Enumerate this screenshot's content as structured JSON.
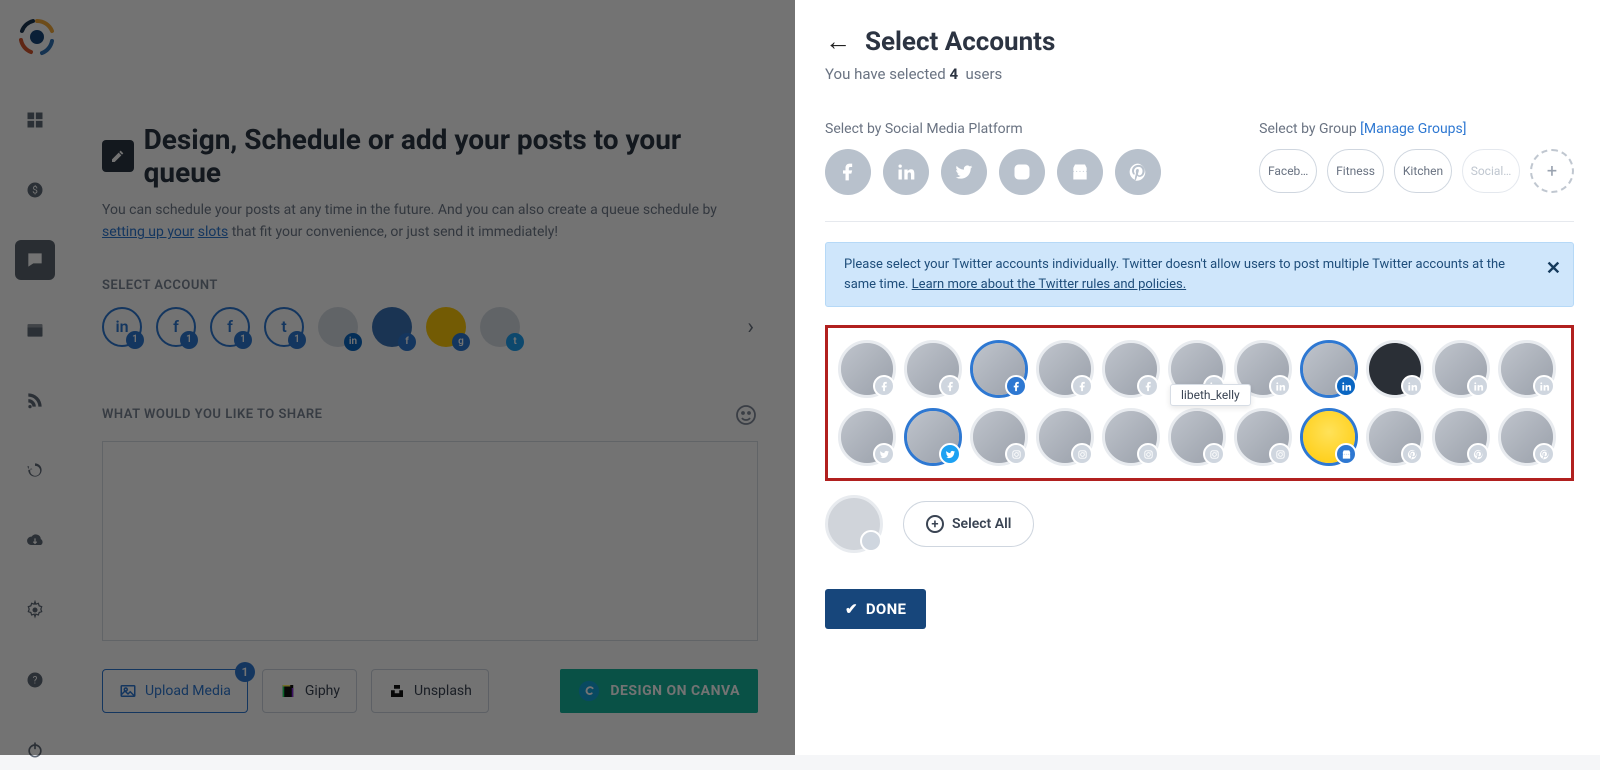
{
  "colors": {
    "accent": "#2e78d2",
    "done": "#17467b",
    "highlight_border": "#b1201f",
    "alert_bg": "#cfe6fb"
  },
  "header": {
    "title": "Design, Schedule or add your posts to your queue",
    "sub_prefix": "You can schedule your posts at any time in the future. And you can also create a queue schedule by ",
    "sub_link1": "setting up your",
    "sub_mid": " ",
    "sub_link2": "slots",
    "sub_suffix": " that fit your convenience, or just send it immediately!"
  },
  "select_account_label": "SELECT ACCOUNT",
  "share_label": "WHAT WOULD YOU LIKE TO SHARE",
  "media": {
    "upload": "Upload Media",
    "upload_badge": "1",
    "giphy": "Giphy",
    "unsplash": "Unsplash",
    "canva": "DESIGN ON CANVA"
  },
  "panel": {
    "title": "Select Accounts",
    "selected_prefix": "You have selected ",
    "selected_count": "4",
    "selected_suffix": "users",
    "platform_label": "Select by Social Media Platform",
    "group_label": "Select by Group ",
    "manage_groups": "[Manage Groups]",
    "groups": [
      "Faceb…",
      "Fitness",
      "Kitchen",
      "Social…"
    ],
    "alert_text": "Please select your Twitter accounts individually. Twitter doesn't allow users to post multiple Twitter accounts at the same time.",
    "alert_link": "Learn more about the Twitter rules and policies.",
    "tooltip": "libeth_kelly",
    "select_all": "Select All",
    "done": "DONE"
  },
  "accounts": [
    {
      "network": "facebook",
      "selected": false
    },
    {
      "network": "facebook",
      "selected": false
    },
    {
      "network": "facebook",
      "selected": true,
      "variant": "blue"
    },
    {
      "network": "facebook",
      "selected": false
    },
    {
      "network": "facebook",
      "selected": false
    },
    {
      "network": "linkedin",
      "selected": false
    },
    {
      "network": "linkedin",
      "selected": false
    },
    {
      "network": "linkedin",
      "selected": true
    },
    {
      "network": "linkedin",
      "selected": false,
      "variant": "dark"
    },
    {
      "network": "linkedin",
      "selected": false
    },
    {
      "network": "linkedin",
      "selected": false
    },
    {
      "network": "twitter",
      "selected": false
    },
    {
      "network": "twitter",
      "selected": true
    },
    {
      "network": "instagram",
      "selected": false
    },
    {
      "network": "instagram",
      "selected": false
    },
    {
      "network": "instagram",
      "selected": false
    },
    {
      "network": "instagram",
      "selected": false
    },
    {
      "network": "instagram",
      "selected": false
    },
    {
      "network": "gmb",
      "selected": true,
      "variant": "yellow"
    },
    {
      "network": "pinterest",
      "selected": false
    },
    {
      "network": "pinterest",
      "selected": false
    },
    {
      "network": "pinterest",
      "selected": false
    }
  ],
  "platform_filters": [
    "facebook",
    "linkedin",
    "twitter",
    "instagram",
    "gmb",
    "pinterest"
  ]
}
